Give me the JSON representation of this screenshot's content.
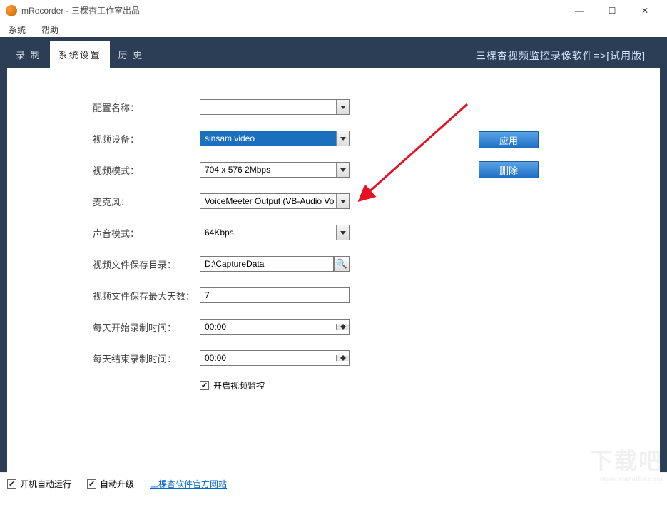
{
  "window": {
    "title": "mRecorder - 三棵杏工作室出品"
  },
  "menu": {
    "system": "系统",
    "help": "帮助"
  },
  "tabs": {
    "record": "录 制",
    "settings": "系统设置",
    "history": "历 史"
  },
  "brand": "三棵杏视频监控录像软件=>[试用版]",
  "labels": {
    "profile_name": "配置名称：",
    "video_device": "视频设备：",
    "video_mode": "视频模式：",
    "microphone": "麦克风：",
    "audio_mode": "声音模式：",
    "save_dir": "视频文件保存目录：",
    "max_days": "视频文件保存最大天数：",
    "start_time": "每天开始录制时间：",
    "end_time": "每天结束录制时间：",
    "enable_monitor": "开启视频监控"
  },
  "values": {
    "profile_name": "",
    "video_device": "sinsam video",
    "video_mode": "704 x 576 2Mbps",
    "microphone": "VoiceMeeter Output (VB-Audio Vo",
    "audio_mode": "64Kbps",
    "save_dir": "D:\\CaptureData",
    "max_days": "7",
    "start_time": "00:00",
    "end_time": "00:00",
    "enable_monitor_checked": true
  },
  "buttons": {
    "apply": "应用",
    "delete": "删除"
  },
  "footer": {
    "autorun": "开机自动运行",
    "autorun_checked": true,
    "autoupdate": "自动升级",
    "autoupdate_checked": true,
    "link": "三棵杏软件官方网站"
  },
  "watermark": {
    "big": "下载吧",
    "small": "www.xiazaiba.com"
  }
}
